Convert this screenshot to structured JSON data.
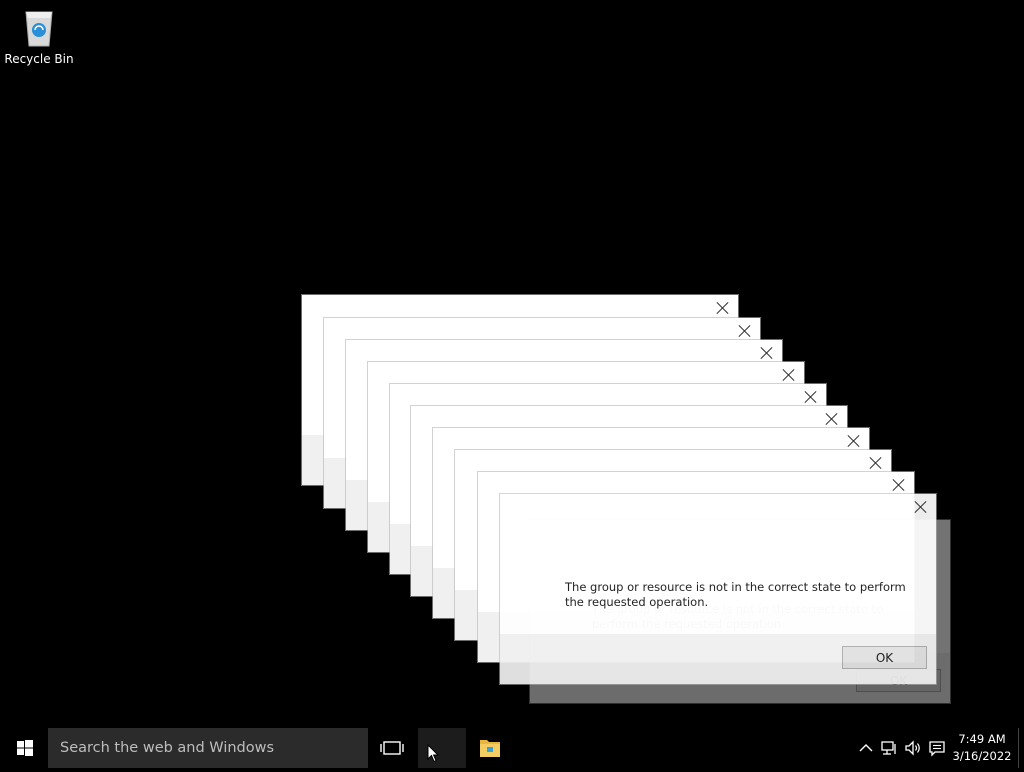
{
  "desktop": {
    "icons": [
      {
        "label": "Recycle Bin",
        "icon": "recycle-bin-icon"
      }
    ]
  },
  "dialogs": {
    "count": 11,
    "message": "The group or resource is not in the correct state to perform the requested operation.",
    "ok_label": "OK",
    "close_icon": "close-icon"
  },
  "taskbar": {
    "start_icon": "windows-start-icon",
    "search_placeholder": "Search the web and Windows",
    "task_view_icon": "task-view-icon",
    "apps": [
      {
        "name": "active-window",
        "icon": "blank-app-icon",
        "active": true
      },
      {
        "name": "file-explorer",
        "icon": "folder-icon",
        "active": false
      }
    ],
    "tray": {
      "icons": [
        "chevron-up-icon",
        "network-icon",
        "speaker-icon",
        "action-center-icon"
      ],
      "time": "7:49 AM",
      "date": "3/16/2022"
    }
  },
  "colors": {
    "taskbar_bg": "#000000",
    "search_bg": "#2b2b2b",
    "dialog_bg": "#ffffff",
    "dialog_footer": "#f0f0f0"
  }
}
